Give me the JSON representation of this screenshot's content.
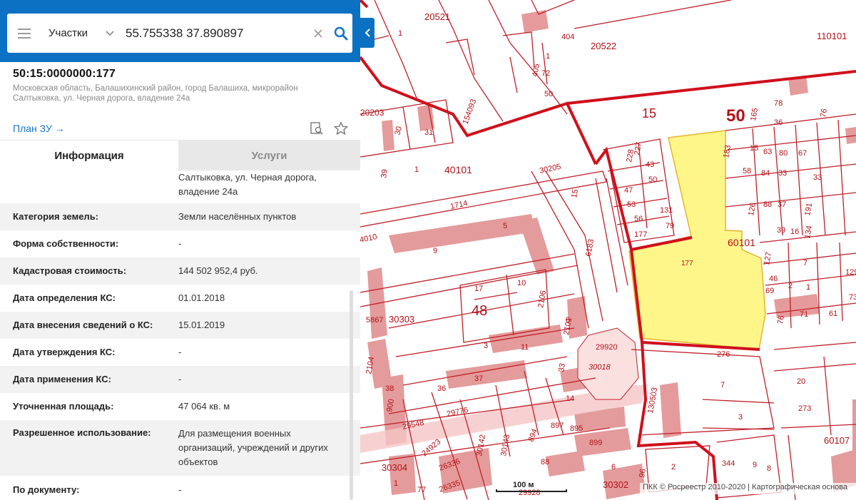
{
  "search": {
    "layer_label": "Участки",
    "query": "55.755338 37.890897"
  },
  "parcel": {
    "cad_number": "50:15:0000000:177",
    "address": "Московская область, Балашихинский район, город Балашиха, микрорайон Салтыковка, ул. Черная дорога, владение 24а",
    "plan_link": "План ЗУ →"
  },
  "tabs": {
    "info": "Информация",
    "services": "Услуги"
  },
  "properties": [
    {
      "label": "",
      "value": "Салтыковка, ул. Черная дорога, владение 24а"
    },
    {
      "label": "Категория земель:",
      "value": "Земли населённых пунктов"
    },
    {
      "label": "Форма собственности:",
      "value": "-"
    },
    {
      "label": "Кадастровая стоимость:",
      "value": "144 502 952,4 руб."
    },
    {
      "label": "Дата определения КС:",
      "value": "01.01.2018"
    },
    {
      "label": "Дата внесения сведений о КС:",
      "value": "15.01.2019"
    },
    {
      "label": "Дата утверждения КС:",
      "value": "-"
    },
    {
      "label": "Дата применения КС:",
      "value": "-"
    },
    {
      "label": "Уточненная площадь:",
      "value": "47 064 кв. м"
    },
    {
      "label": "Разрешенное использование:",
      "value": "Для размещения военных организаций, учреждений и других объектов"
    },
    {
      "label": "По документу:",
      "value": "-"
    }
  ],
  "map": {
    "scale": "100 м",
    "attribution": "ПКК © Росреестр 2010-2020 | Картографическая основа",
    "colors": {
      "boundary": "#d0101b",
      "parcel_line": "#c0202a",
      "building": "#e08a8a",
      "selected_parcel": "#fff68a"
    },
    "labels": [
      "1",
      "20521",
      "404",
      "20522",
      "110101",
      "1",
      "405",
      "72",
      "50",
      "20203",
      "30",
      "31",
      "154093",
      "15",
      "165",
      "78",
      "76",
      "36",
      "39",
      "1",
      "40101",
      "183",
      "15",
      "63",
      "80",
      "67",
      "58",
      "84",
      "33",
      "227",
      "228",
      "43",
      "50",
      "30205",
      "15",
      "47",
      "53",
      "131",
      "56",
      "79",
      "177",
      "1714",
      "6183",
      "5",
      "9",
      "60101",
      "177",
      "127",
      "7",
      "126",
      "88",
      "37",
      "191",
      "39",
      "16",
      "134",
      "46",
      "2",
      "1",
      "69",
      "129",
      "73",
      "4010",
      "17",
      "10",
      "2106",
      "48",
      "5867",
      "30303",
      "8",
      "2101",
      "76",
      "71",
      "61",
      "3",
      "11",
      "29920",
      "276",
      "30018",
      "7",
      "3",
      "33",
      "2104",
      "38",
      "900",
      "36",
      "37",
      "29548",
      "29776",
      "14",
      "130503",
      "20",
      "273",
      "30142",
      "897",
      "895",
      "894",
      "30143",
      "24923",
      "26336",
      "88",
      "899",
      "6",
      "2",
      "344",
      "60107",
      "30304",
      "26335",
      "29928",
      "30302",
      "96",
      "9",
      "8",
      "77",
      "1"
    ]
  }
}
